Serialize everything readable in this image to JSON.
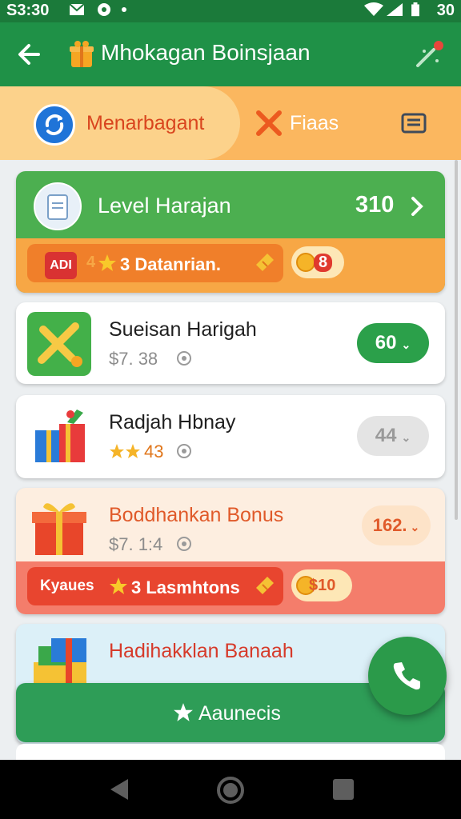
{
  "status_bar": {
    "time": "S3:30",
    "battery": "30"
  },
  "app_bar": {
    "title": "Mhokagan Boinsjaan",
    "back_icon": "back-arrow-icon",
    "action_icon": "magic-wand-icon"
  },
  "tabs": [
    {
      "label": "Menarbagant",
      "icon": "refresh-icon",
      "active": true
    },
    {
      "label": "Fiaas",
      "icon": "close-x-icon",
      "active": false
    },
    {
      "label": "",
      "icon": "menu-icon",
      "active": false
    }
  ],
  "level_card": {
    "title": "Level Harajan",
    "value": "310",
    "banner": {
      "badge": "ADI",
      "prefix": "4",
      "text": "3 Datanrian.",
      "coin_value": "8"
    }
  },
  "items": [
    {
      "title": "Sueisan Harigah",
      "subtitle": "$7. 38",
      "pill": "60",
      "pill_color": "#2ba04a",
      "pill_text_color": "#ffffff"
    },
    {
      "title": "Radjah Hbnay",
      "subtitle": "43",
      "pill": "44",
      "pill_color": "#e4e4e4",
      "pill_text_color": "#9a9a9a"
    },
    {
      "title": "Boddhankan Bonus",
      "subtitle": "$7. 1:4",
      "pill": "162.",
      "pill_color": "#fde3c8",
      "pill_text_color": "#e05a2a",
      "banner": {
        "badge": "Kyaues",
        "text": "3 Lasmhtons",
        "coin_value": "$10"
      }
    },
    {
      "title": "Hadihakklan Banaah",
      "subtitle": ""
    }
  ],
  "cta": {
    "label": "Aaunecis"
  },
  "colors": {
    "primary": "#1f9147",
    "accent_orange": "#fbb75f",
    "danger_red": "#e05a2a"
  }
}
